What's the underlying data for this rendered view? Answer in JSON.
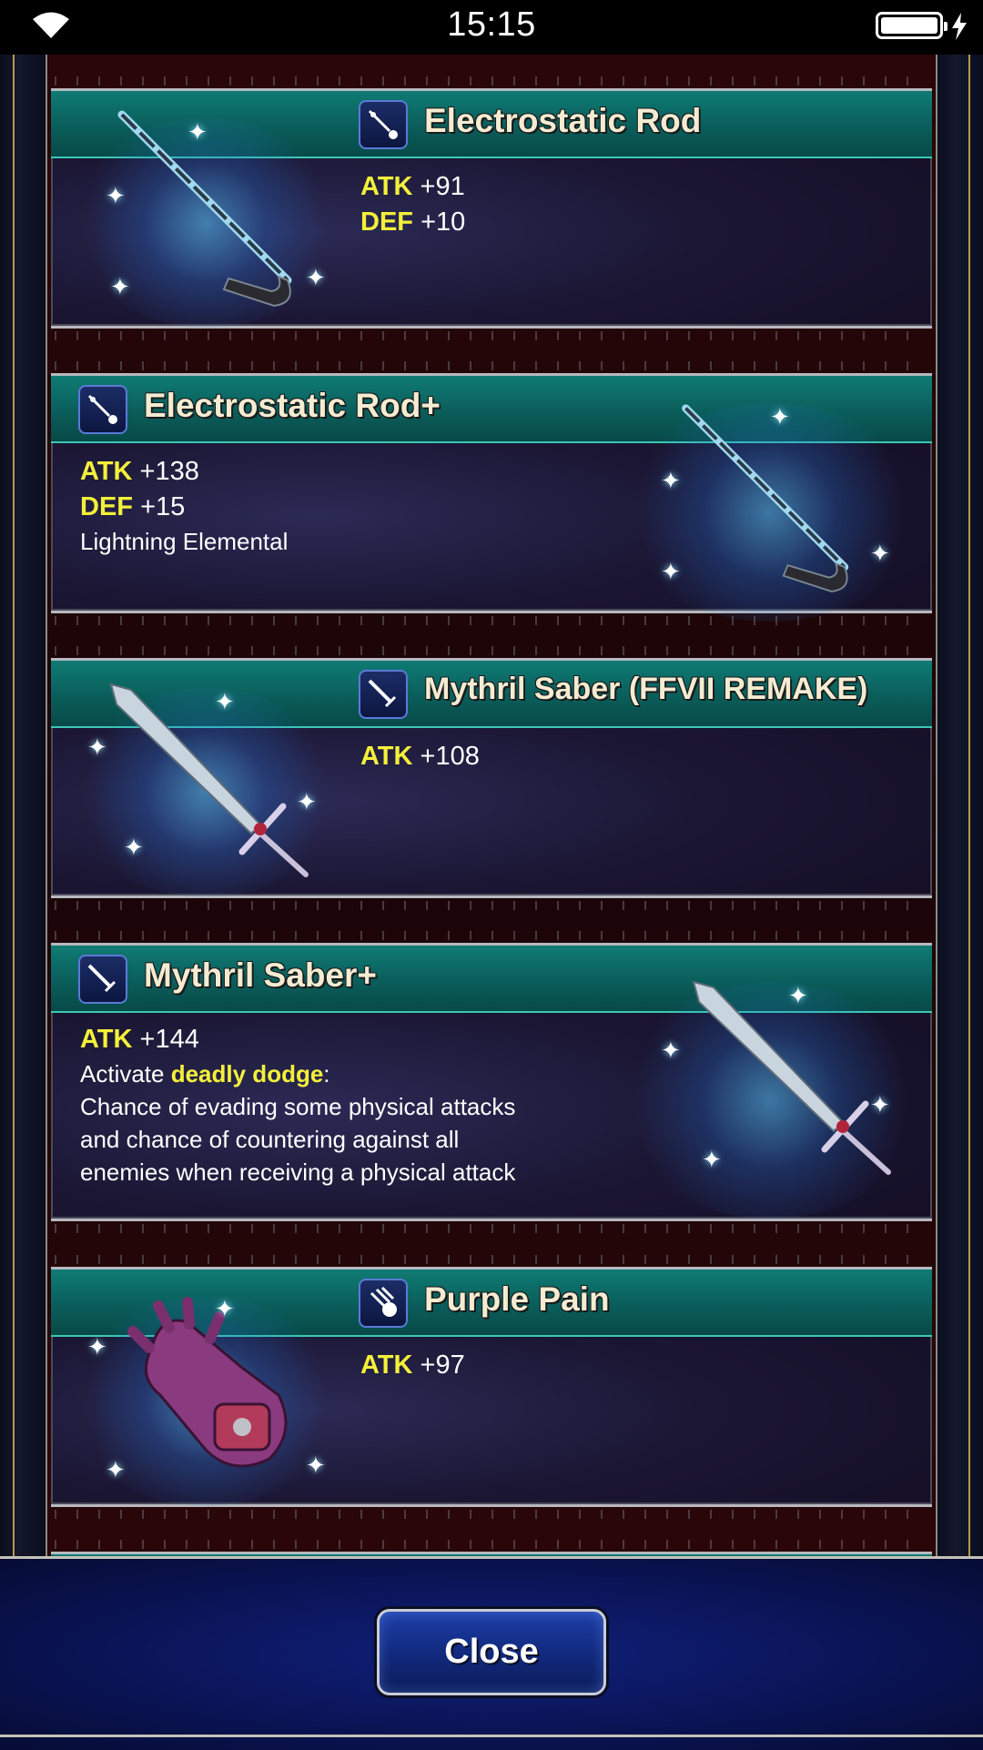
{
  "status_bar": {
    "time": "15:15"
  },
  "items": [
    {
      "name": "Electrostatic Rod",
      "weapon_type": "rod-icon",
      "stats": [
        {
          "key": "ATK",
          "value": "+91"
        },
        {
          "key": "DEF",
          "value": "+10"
        }
      ],
      "description": []
    },
    {
      "name": "Electrostatic Rod+",
      "weapon_type": "rod-icon",
      "stats": [
        {
          "key": "ATK",
          "value": "+138"
        },
        {
          "key": "DEF",
          "value": "+15"
        }
      ],
      "description": [
        "Lightning Elemental"
      ]
    },
    {
      "name": "Mythril Saber (FFVII REMAKE)",
      "weapon_type": "sword-icon",
      "stats": [
        {
          "key": "ATK",
          "value": "+108"
        }
      ],
      "description": []
    },
    {
      "name": "Mythril Saber+",
      "weapon_type": "sword-icon",
      "stats": [
        {
          "key": "ATK",
          "value": "+144"
        }
      ],
      "ability_prefix": "Activate ",
      "ability_name": "deadly dodge",
      "ability_suffix": ":",
      "description": [
        "Chance of evading some physical attacks",
        "and chance of countering against all",
        "enemies when receiving a physical attack"
      ]
    },
    {
      "name": "Purple Pain",
      "weapon_type": "glove-icon",
      "stats": [
        {
          "key": "ATK",
          "value": "+97"
        }
      ],
      "description": []
    }
  ],
  "close_button": {
    "label": "Close"
  },
  "colors": {
    "header_teal": "#0f7b74",
    "stat_yellow": "#f4f03a",
    "button_blue": "#1d3fa8"
  }
}
